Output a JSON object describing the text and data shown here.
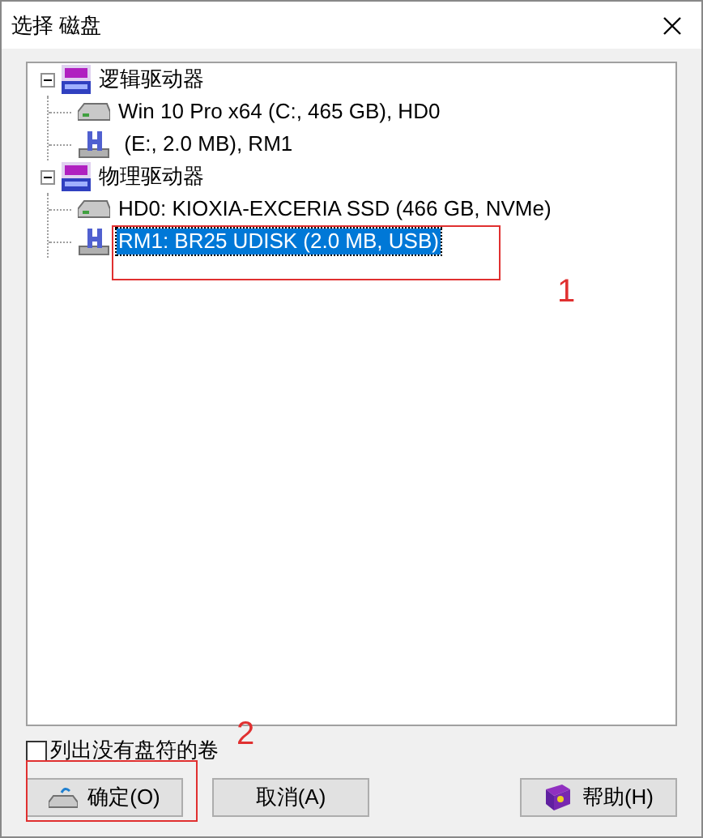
{
  "window": {
    "title": "选择 磁盘"
  },
  "tree": [
    {
      "label": "逻辑驱动器",
      "kind": "hex",
      "expanded": true,
      "selected": false,
      "children": [
        {
          "label": "Win 10 Pro x64 (C:, 465 GB), HD0",
          "kind": "drive",
          "selected": false
        },
        {
          "label": " (E:, 2.0 MB), RM1",
          "kind": "usb",
          "selected": false
        }
      ]
    },
    {
      "label": "物理驱动器",
      "kind": "hex",
      "expanded": true,
      "selected": false,
      "children": [
        {
          "label": "HD0: KIOXIA-EXCERIA SSD (466 GB, NVMe)",
          "kind": "drive",
          "selected": false
        },
        {
          "label": "RM1: BR25 UDISK (2.0 MB, USB)",
          "kind": "usb",
          "selected": true
        }
      ]
    }
  ],
  "option": {
    "label": "列出没有盘符的卷",
    "checked": false
  },
  "buttons": [
    {
      "label": "确定(O)",
      "kind": "ok"
    },
    {
      "label": "取消(A)",
      "kind": "cancel"
    },
    {
      "label": "帮助(H)",
      "kind": "help"
    }
  ],
  "annotations": [
    {
      "label": "1"
    },
    {
      "label": "2"
    }
  ]
}
